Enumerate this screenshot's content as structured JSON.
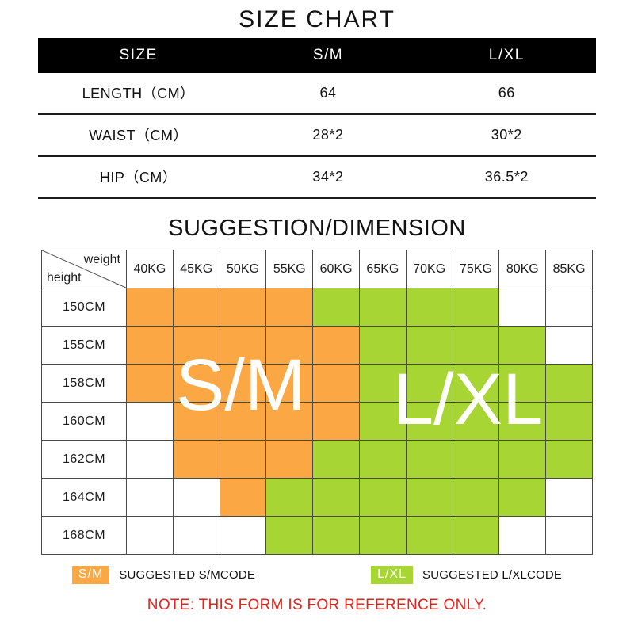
{
  "title": "SIZE CHART",
  "size_table": {
    "headers": [
      "SIZE",
      "S/M",
      "L/XL"
    ],
    "rows": [
      {
        "label": "LENGTH（CM）",
        "sm": "64",
        "lxl": "66"
      },
      {
        "label": "WAIST（CM）",
        "sm": "28*2",
        "lxl": "30*2"
      },
      {
        "label": "HIP（CM）",
        "sm": "34*2",
        "lxl": "36.5*2"
      }
    ]
  },
  "suggestion": {
    "title": "SUGGESTION/DIMENSION",
    "corner": {
      "weight_label": "weight",
      "height_label": "height"
    },
    "overlay": {
      "sm": "S/M",
      "lxl": "L/XL"
    }
  },
  "chart_data": {
    "type": "heatmap",
    "title": "SUGGESTION/DIMENSION",
    "xlabel": "weight",
    "ylabel": "height",
    "categories": [
      "40KG",
      "45KG",
      "50KG",
      "55KG",
      "60KG",
      "65KG",
      "70KG",
      "75KG",
      "80KG",
      "85KG"
    ],
    "rows": [
      "150CM",
      "155CM",
      "158CM",
      "160CM",
      "162CM",
      "164CM",
      "168CM"
    ],
    "legend": [
      {
        "code": "S/M",
        "color": "#FBA844",
        "label": "SUGGESTED S/M CODE"
      },
      {
        "code": "L/XL",
        "color": "#A7D534",
        "label": "SUGGESTED L/XL CODE"
      }
    ],
    "cells": [
      [
        "S/M",
        "S/M",
        "S/M",
        "S/M",
        "L/XL",
        "L/XL",
        "L/XL",
        "L/XL",
        "",
        ""
      ],
      [
        "S/M",
        "S/M",
        "S/M",
        "S/M",
        "S/M",
        "L/XL",
        "L/XL",
        "L/XL",
        "L/XL",
        ""
      ],
      [
        "S/M",
        "S/M",
        "S/M",
        "S/M",
        "S/M",
        "L/XL",
        "L/XL",
        "L/XL",
        "L/XL",
        "L/XL"
      ],
      [
        "",
        "S/M",
        "S/M",
        "S/M",
        "S/M",
        "L/XL",
        "L/XL",
        "L/XL",
        "L/XL",
        "L/XL"
      ],
      [
        "",
        "S/M",
        "S/M",
        "S/M",
        "L/XL",
        "L/XL",
        "L/XL",
        "L/XL",
        "L/XL",
        "L/XL"
      ],
      [
        "",
        "",
        "S/M",
        "L/XL",
        "L/XL",
        "L/XL",
        "L/XL",
        "L/XL",
        "L/XL",
        ""
      ],
      [
        "",
        "",
        "",
        "L/XL",
        "L/XL",
        "L/XL",
        "L/XL",
        "L/XL",
        "",
        ""
      ]
    ]
  },
  "legend": {
    "sm_code": "S/M",
    "sm_text": "SUGGESTED S/MCODE",
    "lxl_code": "L/XL",
    "lxl_text": "SUGGESTED L/XLCODE"
  },
  "note": "NOTE: THIS FORM IS FOR REFERENCE ONLY."
}
